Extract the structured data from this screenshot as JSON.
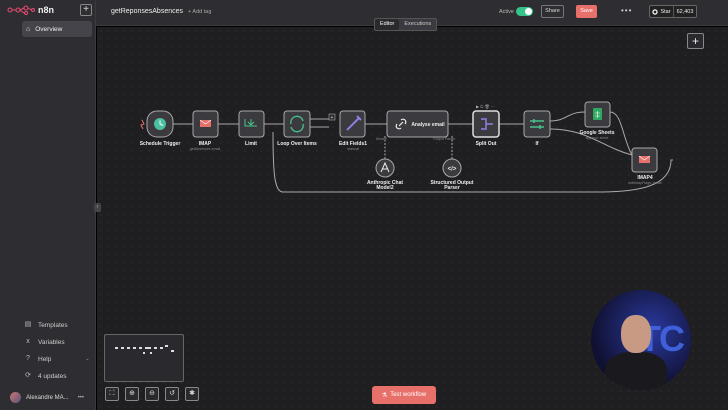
{
  "app": {
    "logo_text": "n8n"
  },
  "sidebar": {
    "overview": "Overview",
    "templates": "Templates",
    "variables": "Variables",
    "help": "Help",
    "updates": "4 updates",
    "user": "Alexandre MA..."
  },
  "topbar": {
    "workflow_name": "getReponsesAbsences",
    "add_tag": "+ Add tag",
    "active_label": "Active",
    "share": "Share",
    "save": "Save",
    "star": "Star",
    "star_count": "62,403"
  },
  "tabs": [
    "Editor",
    "Executions"
  ],
  "nodes": [
    {
      "label": "Schedule Trigger",
      "sub": ""
    },
    {
      "label": "IMAP",
      "sub": "getAbsences email"
    },
    {
      "label": "Limit",
      "sub": ""
    },
    {
      "label": "Loop Over Items",
      "sub": ""
    },
    {
      "label": "Edit Fields1",
      "sub": "manual"
    },
    {
      "label": "Analyse email",
      "sub": ""
    },
    {
      "label": "Split Out",
      "sub": ""
    },
    {
      "label": "If",
      "sub": ""
    },
    {
      "label": "Google Sheets",
      "sub": "append: sheet"
    },
    {
      "label": "IMAP4",
      "sub": "editImapFlags: email"
    },
    {
      "label": "Anthropic Chat Model2",
      "sub": ""
    },
    {
      "label": "Structured Output Parser",
      "sub": ""
    }
  ],
  "port_labels": {
    "model": "Model*",
    "output_parser": "Output Parser"
  },
  "canvas": {
    "test_workflow": "Test workflow"
  },
  "colors": {
    "accent": "#e8706b",
    "active": "#35c38a",
    "canvas": "#1f1f22"
  }
}
